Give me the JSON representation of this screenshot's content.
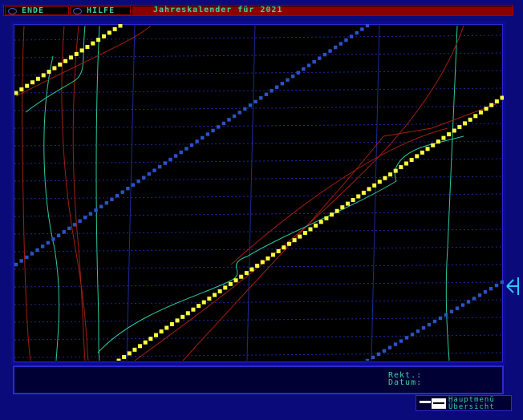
{
  "topbar": {
    "end_label": "ENDE",
    "help_label": "HILFE",
    "title": "Jahreskalender für 2021"
  },
  "info": {
    "rekt_label": "Rekt.:",
    "datum_label": "Datum:",
    "rekt_value": "",
    "datum_value": ""
  },
  "menu": {
    "line1": "Hauptmenü",
    "line2": "Übersicht"
  },
  "colors": {
    "background": "#0a0a7a",
    "sun": "#ffff40",
    "moon": "#2b52c8",
    "planet_red": "#a02010",
    "planet_cyan": "#2ec8a0",
    "grid": "#1b2b9a"
  }
}
